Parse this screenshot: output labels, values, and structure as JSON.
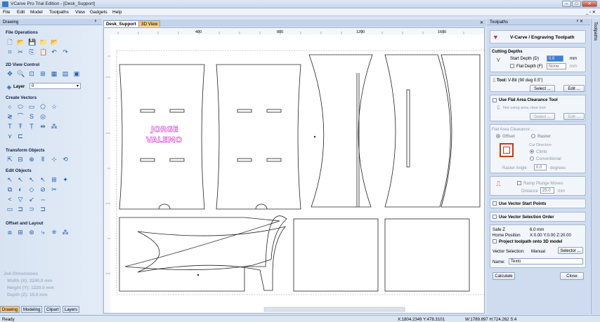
{
  "window": {
    "title": "VCarve Pro Trial Edition - [Desk_Support]"
  },
  "menu": [
    "File",
    "Edit",
    "Model",
    "Toolpaths",
    "View",
    "Gadgets",
    "Help"
  ],
  "left_panel": {
    "header": "Drawing",
    "sections": {
      "file_ops": "File Operations",
      "view_control": "2D View Control",
      "layer_label": "Layer",
      "layer_value": "0",
      "create_vectors": "Create Vectors",
      "transform": "Transform Objects",
      "edit_objects": "Edit Objects",
      "offset_layout": "Offset and Layout"
    },
    "job": {
      "title": "Job Dimensions",
      "width": "Width  (X): 2240.0 mm",
      "height": "Height (Y): 1220.0 mm",
      "depth": "Depth  (Z): 15.0 mm"
    },
    "tabs": [
      "Drawing",
      "Modeling",
      "Clipart",
      "Layers"
    ]
  },
  "view_tabs": [
    "Desk_Support",
    "3D View"
  ],
  "ruler": [
    "400",
    "800",
    "1200",
    "1600"
  ],
  "canvas_text": [
    "JORGE",
    "VALEMO"
  ],
  "right_panel": {
    "header": "Toolpaths",
    "title": "V-Carve / Engraving Toolpath",
    "cutting_depths": "Cutting Depths",
    "start_depth_label": "Start Depth (D)",
    "start_depth_value": "0.0",
    "unit": "mm",
    "flat_depth_label": "Flat Depth (F)",
    "flat_depth_value": "None",
    "tool_label": "Tool:",
    "tool_value": "V-Bit (90 deg 0.5\")",
    "select_btn": "Select ...",
    "edit_btn": "Edit ...",
    "flat_clear_tool": "Use Flat Area Clearance Tool",
    "no_flat_tool": "Not using area clear tool",
    "flat_clear_title": "Flat Area Clearance ...",
    "offset": "Offset",
    "raster": "Raster",
    "cut_direction": "Cut Direction",
    "climb": "Climb",
    "conventional": "Conventional",
    "raster_angle_label": "Raster Angle",
    "raster_angle_value": "0.0",
    "degrees": "degrees",
    "ramp_plunge": "Ramp Plunge Moves",
    "distance_label": "Distance",
    "distance_value": "25.0",
    "vector_start": "Use Vector Start Points",
    "vector_order": "Use Vector Selection Order",
    "safe_z_label": "Safe Z",
    "safe_z_value": "6.0 mm",
    "home_label": "Home Position",
    "home_value": "X:0.00 Y:0.00 Z:20.00",
    "project_3d": "Project toolpath onto 3D model",
    "vector_selection_label": "Vector Selection:",
    "vector_selection_value": "Manual",
    "selector_btn": "Selector ...",
    "name_label": "Name:",
    "name_value": "Texto",
    "calculate": "Calculate",
    "close": "Close"
  },
  "side_tab": "Toolpaths",
  "status": {
    "ready": "Ready",
    "coords": "X:1804.2349 Y:478.3101",
    "dims": "W:1789.897  H:724.262  S:4"
  },
  "colors": {
    "accent_text": "#d63fd6",
    "panel": "#d9e4f1"
  }
}
